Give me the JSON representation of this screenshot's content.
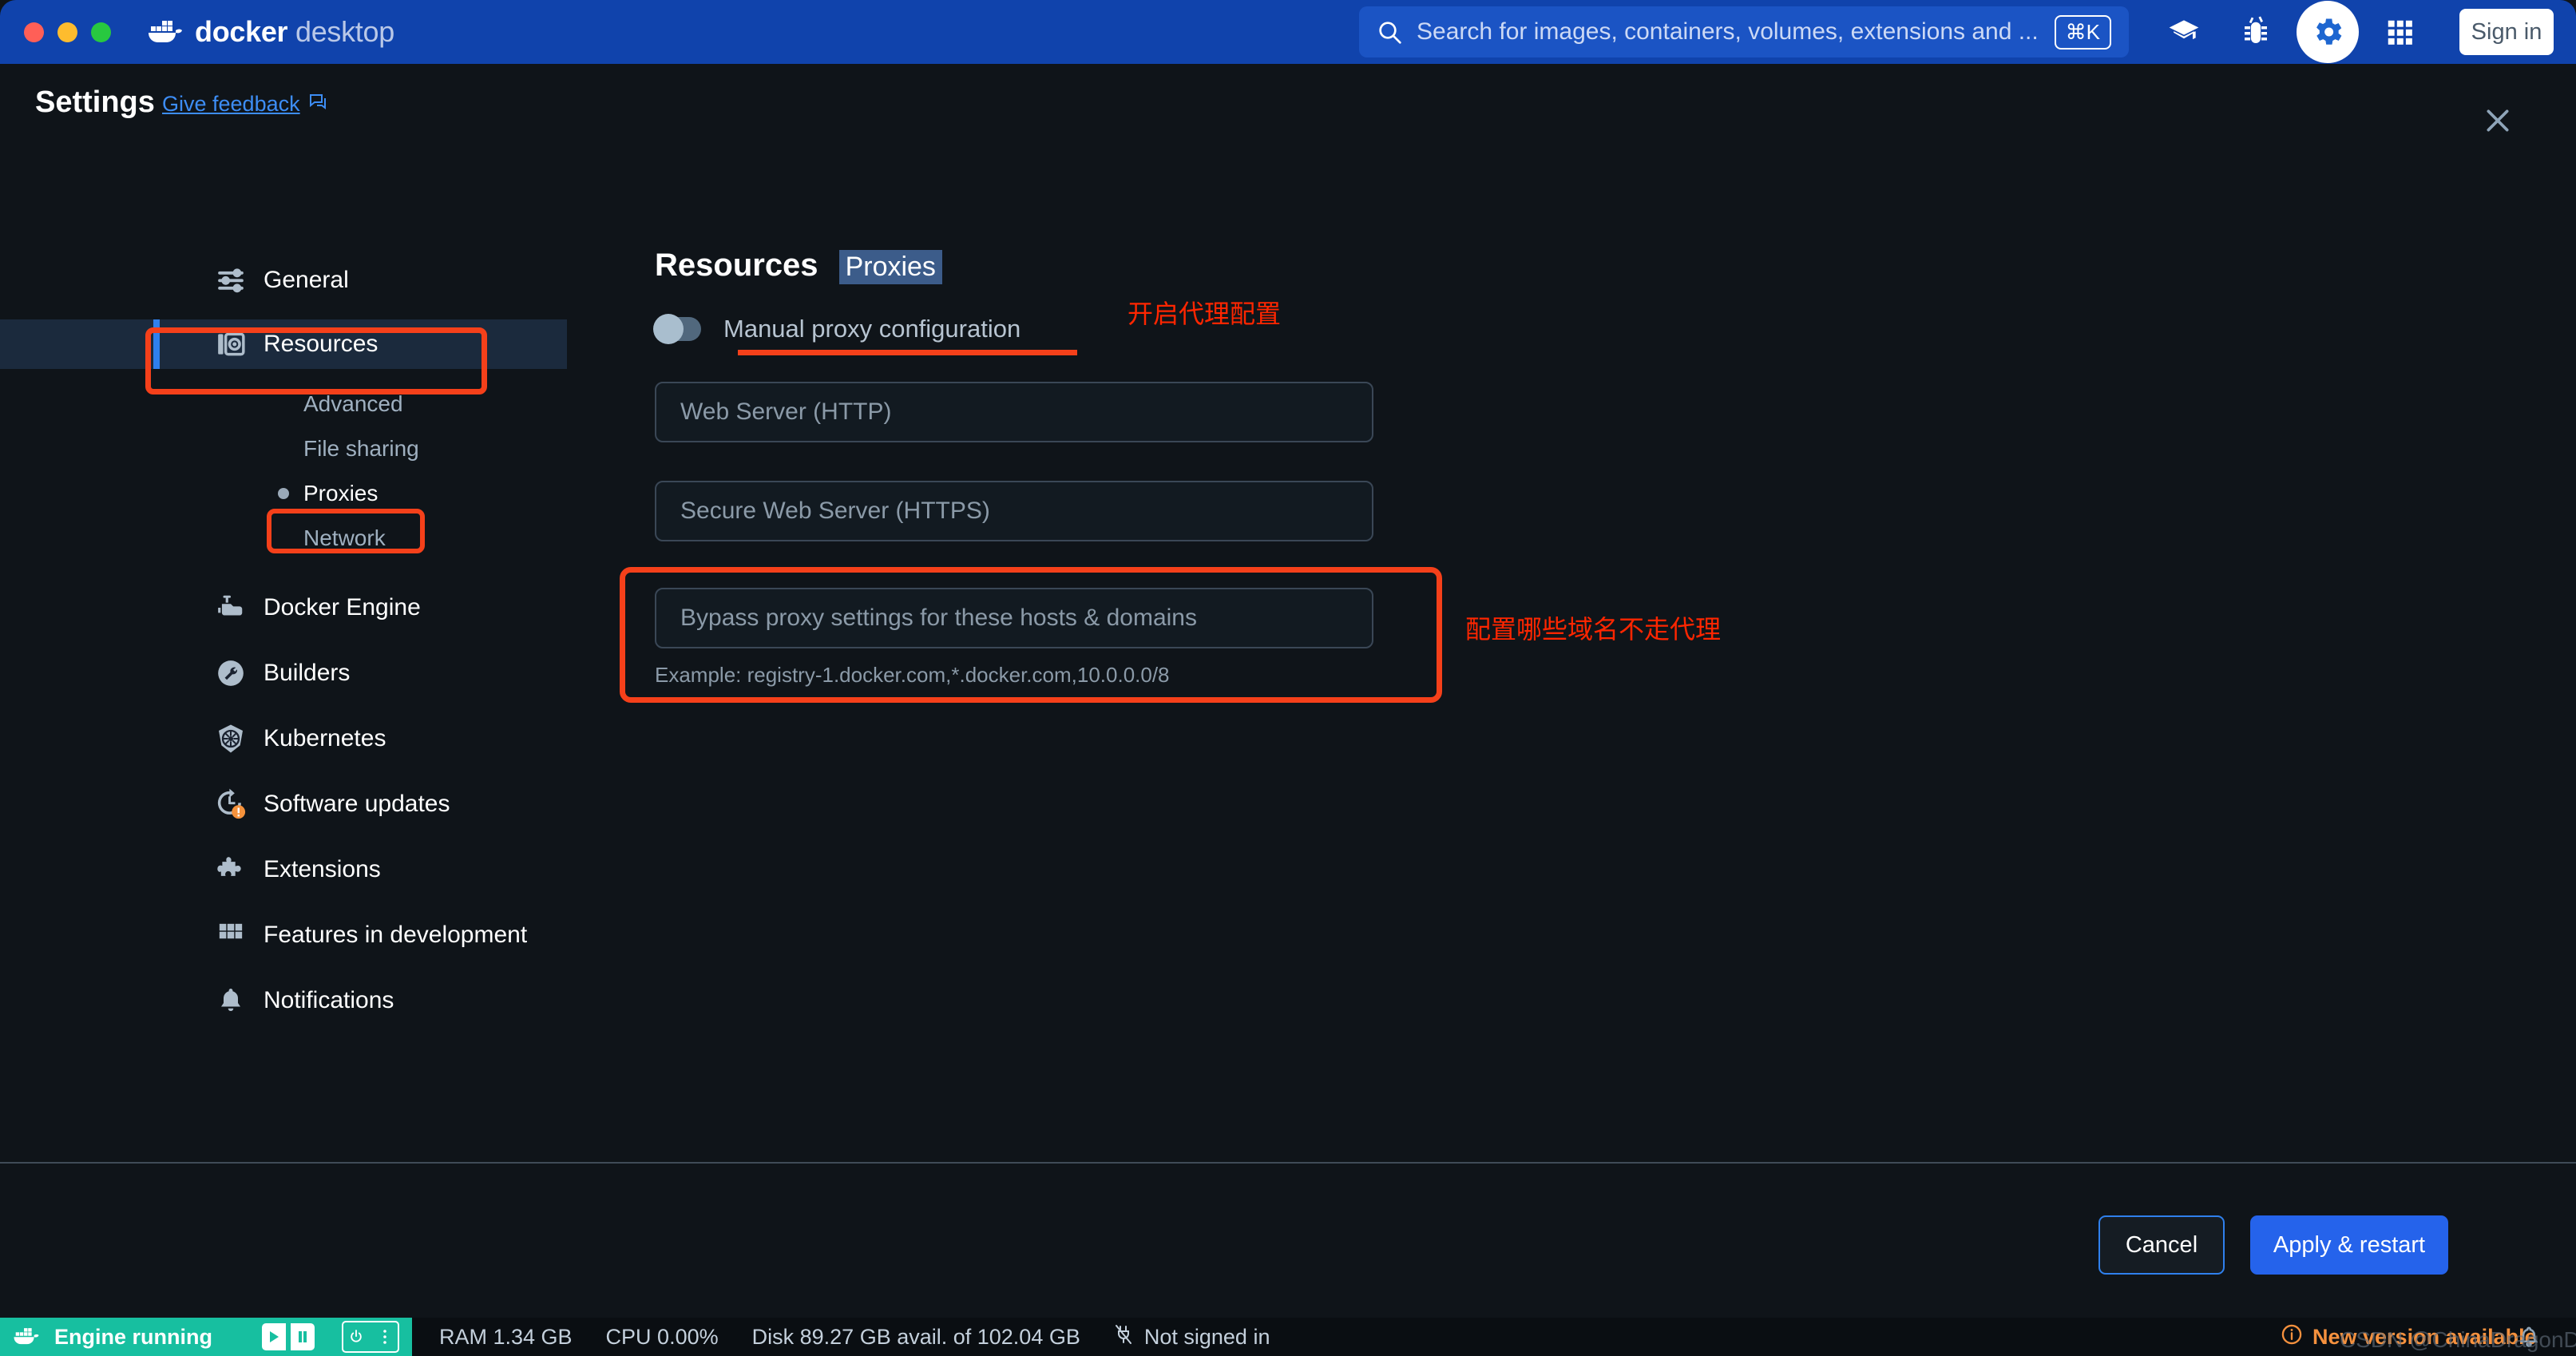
{
  "titlebar": {
    "brand_bold": "docker",
    "brand_light": "desktop",
    "search_placeholder": "Search for images, containers, volumes, extensions and ...",
    "search_shortcut": "⌘K",
    "signin_label": "Sign in",
    "icons": [
      "learning-center-icon",
      "bug-icon",
      "gear-icon",
      "apps-grid-icon"
    ],
    "accent_blue": "#1043ac"
  },
  "header": {
    "title": "Settings",
    "feedback_link": "Give feedback",
    "close_label": "×"
  },
  "sidebar": {
    "items": [
      {
        "label": "General",
        "icon": "sliders-icon",
        "active": false
      },
      {
        "label": "Resources",
        "icon": "resources-icon",
        "active": true
      },
      {
        "label": "Docker Engine",
        "icon": "engine-icon",
        "active": false
      },
      {
        "label": "Builders",
        "icon": "wrench-icon",
        "active": false
      },
      {
        "label": "Kubernetes",
        "icon": "kubernetes-icon",
        "active": false
      },
      {
        "label": "Software updates",
        "icon": "history-clock-icon",
        "active": false
      },
      {
        "label": "Extensions",
        "icon": "puzzle-icon",
        "active": false
      },
      {
        "label": "Features in development",
        "icon": "grid-icon",
        "active": false
      },
      {
        "label": "Notifications",
        "icon": "bell-icon",
        "active": false
      }
    ],
    "subitems": [
      {
        "label": "Advanced",
        "selected": false
      },
      {
        "label": "File sharing",
        "selected": false
      },
      {
        "label": "Proxies",
        "selected": true
      },
      {
        "label": "Network",
        "selected": false
      }
    ]
  },
  "main": {
    "section_title": "Resources",
    "tab_label": "Proxies",
    "toggle_label": "Manual proxy configuration",
    "toggle_state": "off",
    "http_placeholder": "Web Server (HTTP)",
    "https_placeholder": "Secure Web Server (HTTPS)",
    "bypass_placeholder": "Bypass proxy settings for these hosts & domains",
    "bypass_example": "Example: registry-1.docker.com,*.docker.com,10.0.0.0/8"
  },
  "annotations": {
    "color": "#ff2600",
    "note_toggle": "开启代理配置",
    "note_bypass": "配置哪些域名不走代理"
  },
  "footer": {
    "cancel_label": "Cancel",
    "apply_label": "Apply & restart"
  },
  "statusbar": {
    "engine_status": "Engine running",
    "ram": "RAM 1.34 GB",
    "cpu": "CPU 0.00%",
    "disk": "Disk 89.27 GB avail. of 102.04 GB",
    "account": "Not signed in",
    "new_version": "New version available",
    "watermark": "CSDN @ChinaDragonDreamer",
    "engine_color": "#17bfa0",
    "warn_color": "#f5913e"
  }
}
